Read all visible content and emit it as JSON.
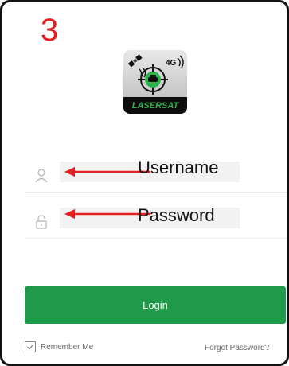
{
  "step_number": "3",
  "app_logo": {
    "brand_text": "LASERSAT",
    "network_badge": "4G"
  },
  "form": {
    "username": {
      "annotation_label": "Username",
      "icon": "user-icon"
    },
    "password": {
      "annotation_label": "Password",
      "icon": "lock-icon"
    }
  },
  "login_button_label": "Login",
  "remember_me": {
    "label": "Remember Me",
    "checked": true
  },
  "forgot_password_label": "Forgot Password?",
  "colors": {
    "annotation_red": "#e32020",
    "login_green": "#1f9a4a",
    "logo_green": "#2db34a"
  }
}
